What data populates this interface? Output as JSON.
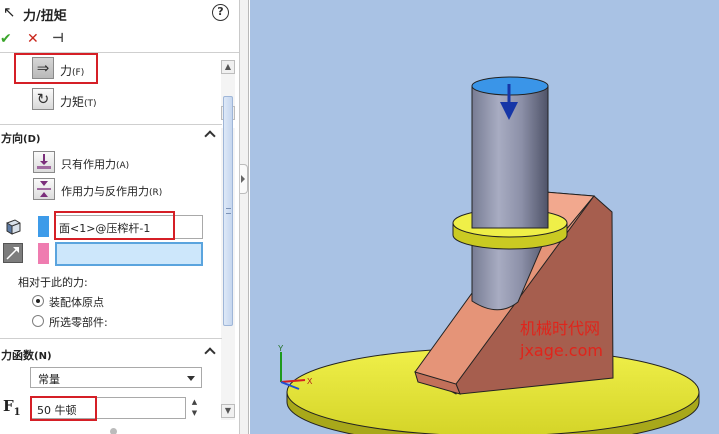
{
  "panel": {
    "title": "力/扭矩",
    "help_label": "?",
    "actions": {
      "ok_icon": "check-icon",
      "cancel_icon": "close-icon",
      "pin_icon": "pushpin-icon"
    },
    "type_options": [
      {
        "label": "力",
        "shortcut": "(F)",
        "icon": "force-arrow-icon",
        "selected": true
      },
      {
        "label": "力矩",
        "shortcut": "(T)",
        "icon": "torque-rotate-icon",
        "selected": false
      }
    ],
    "direction_group": {
      "title": "方向",
      "shortcut": "(D)",
      "options": [
        {
          "label": "只有作用力",
          "shortcut": "(A)",
          "icon": "action-only-icon"
        },
        {
          "label": "作用力与反作用力",
          "shortcut": "(R)",
          "icon": "action-reaction-icon"
        }
      ],
      "face_selection": "面<1>@压榨杆-1",
      "direction_selection": "",
      "face_color": "#3d9be9",
      "direction_color": "#ef7cb0"
    },
    "relative_label": "相对于此的力:",
    "relative_options": [
      {
        "label": "装配体原点",
        "checked": true
      },
      {
        "label": "所选零部件:",
        "checked": false
      }
    ],
    "function_group": {
      "title": "力函数",
      "shortcut": "(N)",
      "function_value": "常量",
      "force_symbol": "F",
      "force_subscript": "1",
      "force_value": "50 牛顿"
    }
  },
  "viewport": {
    "watermark_line1": "机械时代网",
    "watermark_line2": "jxage.com",
    "watermark_color": "#e0241b",
    "triad": {
      "y_label": "Y",
      "x_label": "X"
    }
  }
}
